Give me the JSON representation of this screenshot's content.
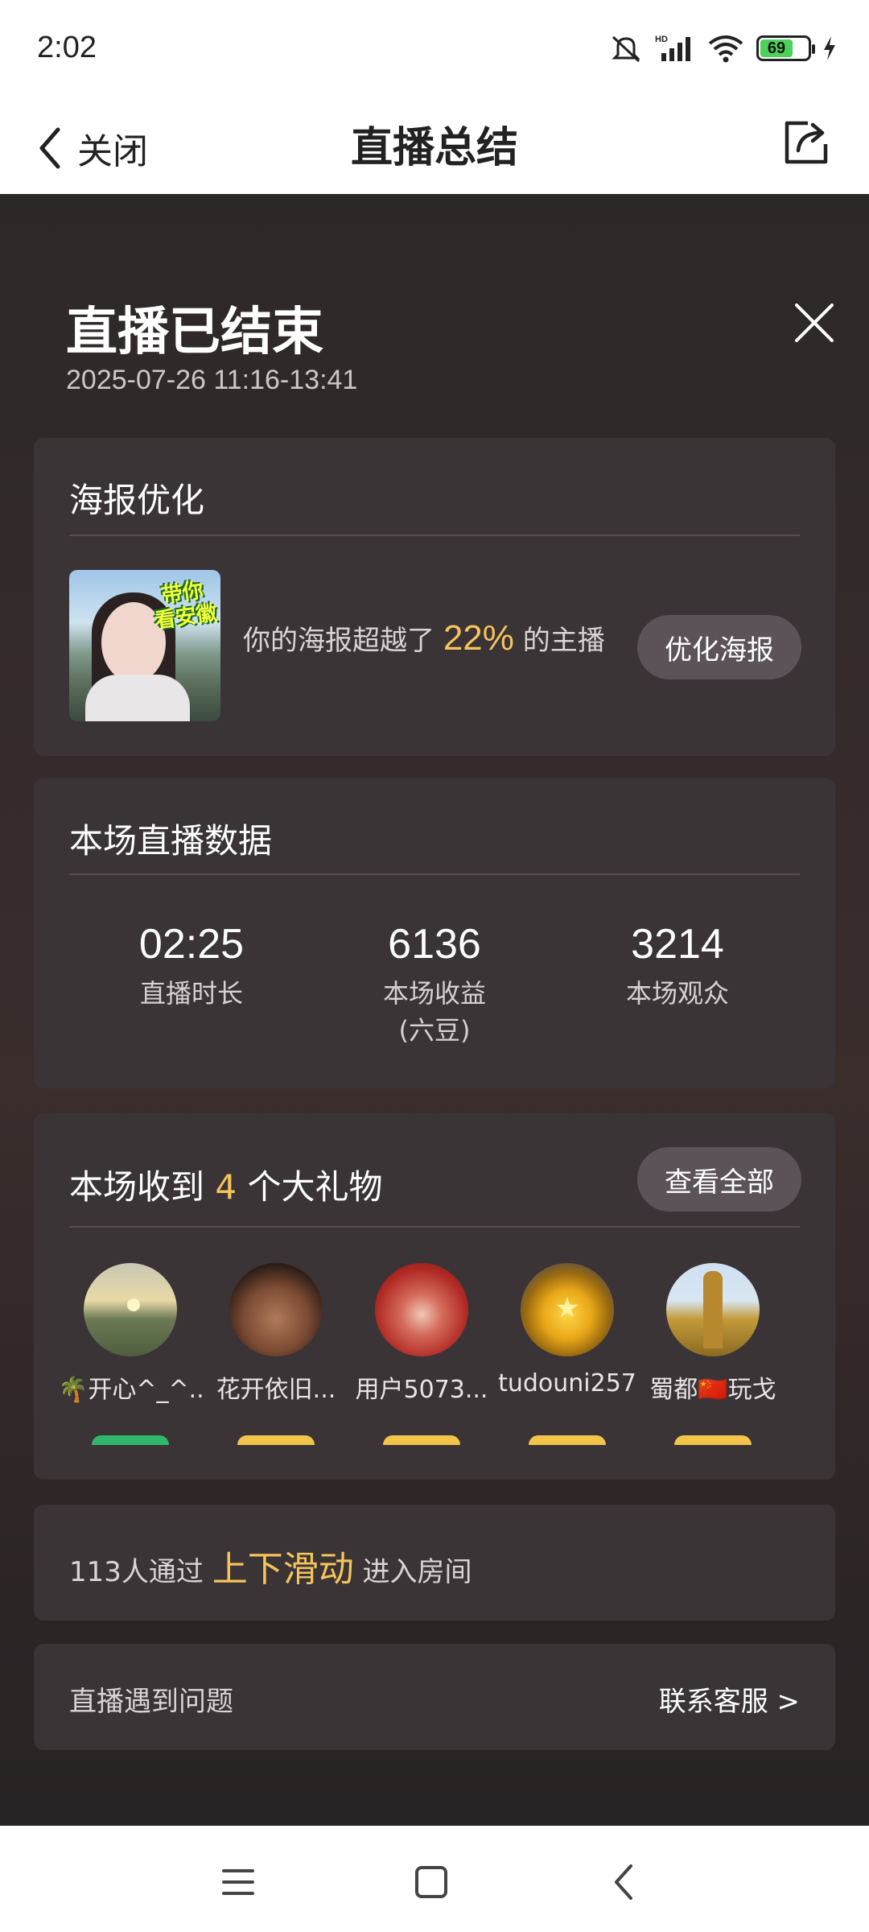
{
  "status_bar": {
    "time": "2:02",
    "battery": "69"
  },
  "nav": {
    "back_label": "关闭",
    "title": "直播总结"
  },
  "summary": {
    "title": "直播已结束",
    "time_range": "2025-07-26 11:16-13:41"
  },
  "poster": {
    "title": "海报优化",
    "image_tag": "带你\n看安徽",
    "text_prefix": "你的海报超越了",
    "percent": "22%",
    "text_suffix": "的主播",
    "button": "优化海报"
  },
  "stats": {
    "title": "本场直播数据",
    "items": [
      {
        "value": "02:25",
        "label": "直播时长"
      },
      {
        "value": "6136",
        "label": "本场收益\n(六豆)"
      },
      {
        "value": "3214",
        "label": "本场观众"
      }
    ]
  },
  "gifts": {
    "title_prefix": "本场收到",
    "count": "4",
    "title_suffix": "个大礼物",
    "view_all": "查看全部",
    "gifters": [
      {
        "name": "🌴开心^_^...",
        "avatar": "sunset-landscape"
      },
      {
        "name": "花开依旧...",
        "avatar": "muscle-torso"
      },
      {
        "name": "用户5073...",
        "avatar": "red-veil"
      },
      {
        "name": "tudouni257",
        "avatar": "gold-medal"
      },
      {
        "name": "蜀都🇨🇳玩戈",
        "avatar": "golden-statue"
      }
    ]
  },
  "slide": {
    "prefix": "113人通过",
    "highlight": "上下滑动",
    "suffix": "进入房间"
  },
  "help": {
    "left": "直播遇到问题",
    "right": "联系客服 >"
  },
  "colors": {
    "accent": "#f5c45b",
    "card": "#3a3437",
    "button": "#5c5358"
  }
}
